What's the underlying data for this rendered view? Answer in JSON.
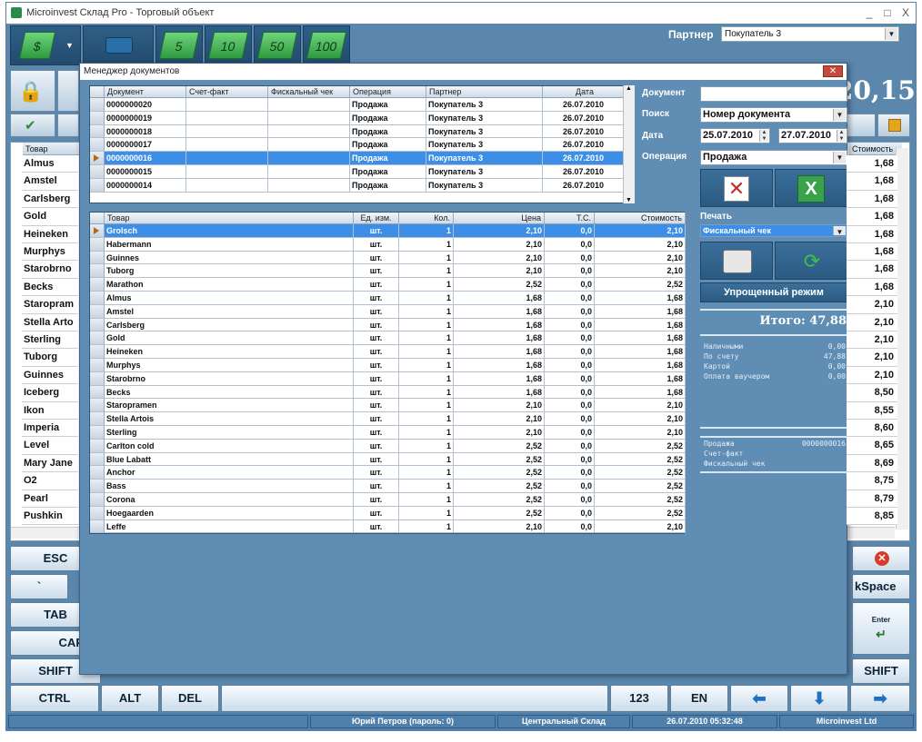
{
  "app": {
    "title": "Microinvest Склад Pro - Торговый объект",
    "controls": [
      "_",
      "□",
      "X"
    ]
  },
  "toolbar": {
    "bills": [
      "5",
      "10",
      "50",
      "100"
    ],
    "partner_label": "Партнер",
    "partner_value": "Покупатель 3",
    "big_total": "20,15"
  },
  "background": {
    "header_product": "Товар",
    "header_value": "Стоимость",
    "products": [
      "Almus",
      "Amstel",
      "Carlsberg",
      "Gold",
      "Heineken",
      "Murphys",
      "Starobrno",
      "Becks",
      "Staropram",
      "Stella Arto",
      "Sterling",
      "Tuborg",
      "Guinnes",
      "Iceberg",
      "Ikon",
      "Imperia",
      "Level",
      "Mary Jane",
      "O2",
      "Pearl",
      "Pushkin"
    ],
    "values": [
      "1,68",
      "1,68",
      "1,68",
      "1,68",
      "1,68",
      "1,68",
      "1,68",
      "1,68",
      "2,10",
      "2,10",
      "2,10",
      "2,10",
      "2,10",
      "8,50",
      "8,55",
      "8,60",
      "8,65",
      "8,69",
      "8,75",
      "8,79",
      "8,85"
    ]
  },
  "keyboard": {
    "esc": "ESC",
    "backtick": "`",
    "tab": "TAB",
    "caps": "CAP",
    "shift_left": "SHIFT",
    "ctrl": "CTRL",
    "alt": "ALT",
    "del": "DEL",
    "num": "123",
    "lang": "EN",
    "backspace": "kSpace",
    "enter": "Enter",
    "shift_right": "SHIFT"
  },
  "status": {
    "user": "Юрий Петров (пароль: 0)",
    "warehouse": "Центральный Склад",
    "datetime": "26.07.2010 05:32:48",
    "brand": "Microinvest Ltd"
  },
  "dialog": {
    "title": "Менеджер документов",
    "doc_headers": [
      "Документ",
      "Счет-факт",
      "Фискальный чек",
      "Операция",
      "Партнер",
      "Дата"
    ],
    "docs": [
      [
        "0000000020",
        "",
        "",
        "Продажа",
        "Покупатель 3",
        "26.07.2010"
      ],
      [
        "0000000019",
        "",
        "",
        "Продажа",
        "Покупатель 3",
        "26.07.2010"
      ],
      [
        "0000000018",
        "",
        "",
        "Продажа",
        "Покупатель 3",
        "26.07.2010"
      ],
      [
        "0000000017",
        "",
        "",
        "Продажа",
        "Покупатель 3",
        "26.07.2010"
      ],
      [
        "0000000016",
        "",
        "",
        "Продажа",
        "Покупатель 3",
        "26.07.2010"
      ],
      [
        "0000000015",
        "",
        "",
        "Продажа",
        "Покупатель 3",
        "26.07.2010"
      ],
      [
        "0000000014",
        "",
        "",
        "Продажа",
        "Покупатель 3",
        "26.07.2010"
      ]
    ],
    "item_headers": [
      "Товар",
      "Ед. изм.",
      "Кол.",
      "Цена",
      "Т.С.",
      "Стоимость"
    ],
    "items": [
      [
        "Grolsch",
        "шт.",
        "1",
        "2,10",
        "0,0",
        "2,10"
      ],
      [
        "Habermann",
        "шт.",
        "1",
        "2,10",
        "0,0",
        "2,10"
      ],
      [
        "Guinnes",
        "шт.",
        "1",
        "2,10",
        "0,0",
        "2,10"
      ],
      [
        "Tuborg",
        "шт.",
        "1",
        "2,10",
        "0,0",
        "2,10"
      ],
      [
        "Marathon",
        "шт.",
        "1",
        "2,52",
        "0,0",
        "2,52"
      ],
      [
        "Almus",
        "шт.",
        "1",
        "1,68",
        "0,0",
        "1,68"
      ],
      [
        "Amstel",
        "шт.",
        "1",
        "1,68",
        "0,0",
        "1,68"
      ],
      [
        "Carlsberg",
        "шт.",
        "1",
        "1,68",
        "0,0",
        "1,68"
      ],
      [
        "Gold",
        "шт.",
        "1",
        "1,68",
        "0,0",
        "1,68"
      ],
      [
        "Heineken",
        "шт.",
        "1",
        "1,68",
        "0,0",
        "1,68"
      ],
      [
        "Murphys",
        "шт.",
        "1",
        "1,68",
        "0,0",
        "1,68"
      ],
      [
        "Starobrno",
        "шт.",
        "1",
        "1,68",
        "0,0",
        "1,68"
      ],
      [
        "Becks",
        "шт.",
        "1",
        "1,68",
        "0,0",
        "1,68"
      ],
      [
        "Staropramen",
        "шт.",
        "1",
        "2,10",
        "0,0",
        "2,10"
      ],
      [
        "Stella Artois",
        "шт.",
        "1",
        "2,10",
        "0,0",
        "2,10"
      ],
      [
        "Sterling",
        "шт.",
        "1",
        "2,10",
        "0,0",
        "2,10"
      ],
      [
        "Carlton cold",
        "шт.",
        "1",
        "2,52",
        "0,0",
        "2,52"
      ],
      [
        "Blue Labatt",
        "шт.",
        "1",
        "2,52",
        "0,0",
        "2,52"
      ],
      [
        "Anchor",
        "шт.",
        "1",
        "2,52",
        "0,0",
        "2,52"
      ],
      [
        "Bass",
        "шт.",
        "1",
        "2,52",
        "0,0",
        "2,52"
      ],
      [
        "Corona",
        "шт.",
        "1",
        "2,52",
        "0,0",
        "2,52"
      ],
      [
        "Hoegaarden",
        "шт.",
        "1",
        "2,52",
        "0,0",
        "2,52"
      ],
      [
        "Leffe",
        "шт.",
        "1",
        "2,10",
        "0,0",
        "2,10"
      ]
    ],
    "filters": {
      "document_label": "Документ",
      "document_value": "",
      "search_label": "Поиск",
      "search_value": "Номер документа",
      "date_label": "Дата",
      "date_from": "25.07.2010",
      "date_to": "27.07.2010",
      "operation_label": "Операция",
      "operation_value": "Продажа"
    },
    "print": {
      "label": "Печать",
      "value": "Фискальный чек",
      "simple_mode": "Упрощенный режим"
    },
    "total": "Итого:  47,88",
    "payments": [
      [
        "Наличными",
        "0,00"
      ],
      [
        "По счету",
        "47,88"
      ],
      [
        "Картой",
        "0,00"
      ],
      [
        "Оплата ваучером",
        "0,00"
      ]
    ],
    "doc_info": [
      [
        "Продажа",
        "0000000016"
      ],
      [
        "Счет-факт",
        ""
      ],
      [
        "Фискальный чек",
        ""
      ]
    ],
    "colors": {
      "selected_row": "#3d8ee6",
      "panel": "#5f8db3"
    }
  }
}
